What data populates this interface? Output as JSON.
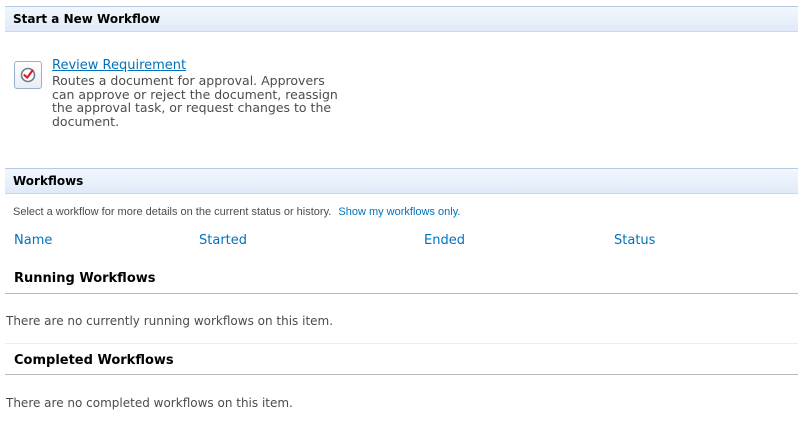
{
  "start_section": {
    "header": "Start a New Workflow",
    "workflow": {
      "icon": "approval-check-icon",
      "title": "Review Requirement",
      "description_lines": [
        "Routes a document for approval. Approvers",
        "can approve or reject the document, reassign",
        "the approval task, or request changes to the",
        "document."
      ]
    }
  },
  "workflows_section": {
    "header": "Workflows",
    "hint": "Select a workflow for more details on the current status or history.",
    "show_mine_link": "Show my workflows only.",
    "columns": [
      "Name",
      "Started",
      "Ended",
      "Status"
    ],
    "running": {
      "title": "Running Workflows",
      "empty_text": "There are no currently running workflows on this item."
    },
    "completed": {
      "title": "Completed Workflows",
      "empty_text": "There are no completed workflows on this item."
    }
  },
  "colors": {
    "link": "#0072bc",
    "header_bg": "#dfeaf8",
    "text": "#4c4c4c"
  }
}
